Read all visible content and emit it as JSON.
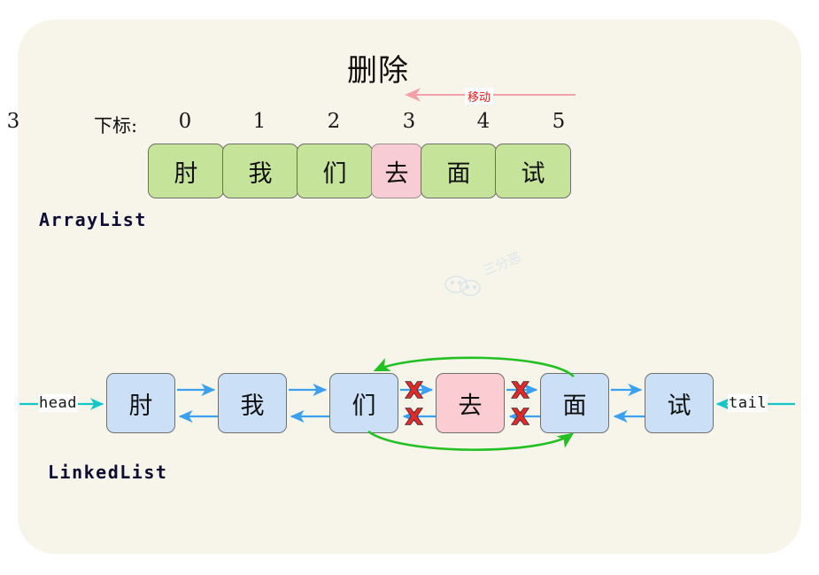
{
  "diagram": {
    "title": "删除",
    "move_label": "移动",
    "watermark_text": "三分恶",
    "background_color": "#f7f4ea",
    "page_color": "#ffffff"
  },
  "arraylist": {
    "name": "ArrayList",
    "index_label": "下标:",
    "indices": [
      "0",
      "1",
      "2",
      "3",
      "4",
      "5"
    ],
    "cells": [
      {
        "text": "肘",
        "state": "kept",
        "color": "#c6e39a"
      },
      {
        "text": "我",
        "state": "kept",
        "color": "#c6e39a"
      },
      {
        "text": "们",
        "state": "kept",
        "color": "#c6e39a"
      },
      {
        "text": "去",
        "state": "deleted",
        "color": "#f8ccd4"
      },
      {
        "text": "面",
        "state": "kept",
        "color": "#c6e39a"
      },
      {
        "text": "试",
        "state": "kept",
        "color": "#c6e39a"
      }
    ],
    "deleted_index": "3",
    "shift_direction": "left"
  },
  "linkedlist": {
    "name": "LinkedList",
    "head_label": "head",
    "tail_label": "tail",
    "nodes": [
      {
        "text": "肘",
        "state": "kept",
        "color": "#cbe0f7"
      },
      {
        "text": "我",
        "state": "kept",
        "color": "#cbe0f7"
      },
      {
        "text": "们",
        "state": "kept",
        "color": "#cbe0f7"
      },
      {
        "text": "去",
        "state": "deleted",
        "color": "#fbcdd2"
      },
      {
        "text": "面",
        "state": "kept",
        "color": "#cbe0f7"
      },
      {
        "text": "试",
        "state": "kept",
        "color": "#cbe0f7"
      }
    ],
    "broken_link_marks": [
      "X",
      "X",
      "X",
      "X"
    ],
    "relink_color": "#22c022",
    "link_color": "#3aa0ef",
    "pointer_color": "#14c8c8"
  }
}
